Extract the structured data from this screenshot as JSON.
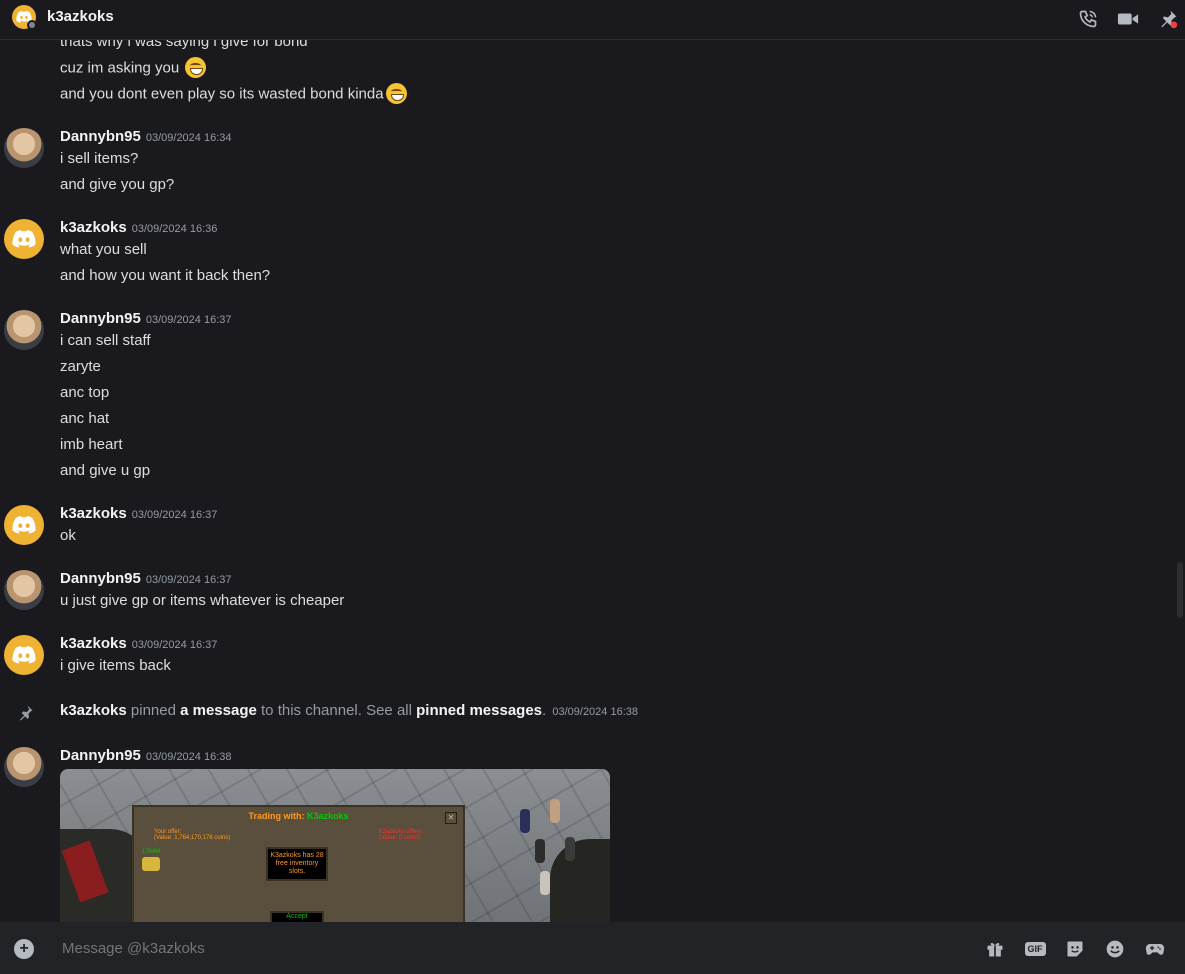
{
  "header": {
    "title": "k3azkoks",
    "icons": [
      "phone-call-icon",
      "video-camera-icon",
      "pin-icon"
    ]
  },
  "messages": {
    "top_lines": [
      "thats why i was saying i give for bond",
      "cuz im asking you",
      "and you dont even play so its wasted bond kinda"
    ],
    "groups": [
      {
        "author": "Dannybn95",
        "timestamp": "03/09/2024 16:34",
        "lines": [
          "i sell items?",
          "and give you gp?"
        ]
      },
      {
        "author": "k3azkoks",
        "timestamp": "03/09/2024 16:36",
        "lines": [
          "what you sell",
          "and how you want it back then?"
        ]
      },
      {
        "author": "Dannybn95",
        "timestamp": "03/09/2024 16:37",
        "lines": [
          "i can sell staff",
          "zaryte",
          "anc top",
          "anc hat",
          "imb heart",
          "and give u gp"
        ]
      },
      {
        "author": "k3azkoks",
        "timestamp": "03/09/2024 16:37",
        "lines": [
          "ok"
        ]
      },
      {
        "author": "Dannybn95",
        "timestamp": "03/09/2024 16:37",
        "lines": [
          "u just give gp or items whatever is cheaper"
        ]
      },
      {
        "author": "k3azkoks",
        "timestamp": "03/09/2024 16:37",
        "lines": [
          "i give items back"
        ]
      },
      {
        "author": "Dannybn95",
        "timestamp": "03/09/2024 16:38",
        "lines": []
      }
    ],
    "system": {
      "actor": "k3azkoks",
      "verb": "pinned",
      "link1": "a message",
      "middle": "to this channel. See all",
      "link2": "pinned messages",
      "end": ".",
      "timestamp": "03/09/2024 16:38"
    }
  },
  "attachment": {
    "trade_title": "Trading with:",
    "trade_partner": "K3azkoks",
    "your_offer": "Your offer:",
    "your_value": "(Value: 1,764,170,178 coins)",
    "their_offer": "K3azkoks offers:",
    "their_value": "(Value: 0 coins)",
    "info": "K3azkoks has 28 free inventory slots.",
    "accept": "Accept",
    "coins_label": "1764M"
  },
  "composer": {
    "placeholder": "Message @k3azkoks",
    "icons": [
      "gift-icon",
      "gif-icon",
      "sticker-icon",
      "emoji-icon",
      "activities-icon"
    ],
    "gif_label": "GIF"
  },
  "colors": {
    "background": "#1a1a1e",
    "composer": "#222327",
    "avatar_yellow": "#f0b232",
    "text": "#dbdee1",
    "muted": "#949ba4"
  }
}
